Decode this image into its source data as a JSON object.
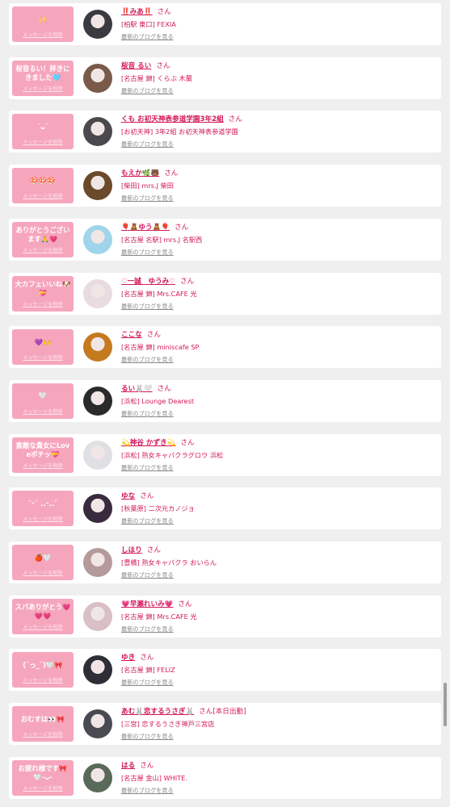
{
  "delete_label": "メッセージを削除",
  "blog_label": "最新のブログを見る",
  "san_label": "さん",
  "colors": {
    "accent": "#d2185a",
    "button_bg": "#f6a6bc",
    "background": "#efefef"
  },
  "rows": [
    {
      "message": "✨",
      "name": "‼️みあ‼️",
      "suffix": "さん",
      "shop": "[柏駅 東口] FEXIA",
      "avatar_color": "#3a3a40"
    },
    {
      "message": "桜音るい！拝きにきました🩵",
      "name": "桜音 るい",
      "suffix": "さん",
      "shop": "[名古屋 錦] くらぶ 木蘭",
      "avatar_color": "#7a5a4a"
    },
    {
      "message": "˙ᴗ˙",
      "name": "くも お初天神表参道学園3年2組",
      "suffix": "さん",
      "shop": "[お初天神] 3年2組 お初天神表参道学園",
      "avatar_color": "#4a4a4e"
    },
    {
      "message": "🍄🍄🍄",
      "name": "もえか🌿🐻",
      "suffix": "さん",
      "shop": "[柴田] mrs.J 柴田",
      "avatar_color": "#6a4a2a"
    },
    {
      "message": "ありがとうございます🙏💗",
      "name": "🎈🧸ゆう🧸🎈",
      "suffix": "さん",
      "shop": "[名古屋 名駅] mrs.J 名駅西",
      "avatar_color": "#9fd4ea"
    },
    {
      "message": "大カフェいいね🐶💝",
      "name": "♡一誠　ゆうみ♡",
      "suffix": "さん",
      "shop": "[名古屋 錦] Mrs.CAFE 光",
      "avatar_color": "#e8dce0"
    },
    {
      "message": "💜🙌",
      "name": "ここな",
      "suffix": "さん",
      "shop": "[名古屋 錦] miniscafe SP",
      "avatar_color": "#c47a1e"
    },
    {
      "message": "🤍",
      "name": "るい🐰🤍",
      "suffix": "さん",
      "shop": "[浜松] Lounge Dearest",
      "avatar_color": "#2a2a2a"
    },
    {
      "message": "素敵な貴女にLoveポチッ💝",
      "name": "💫神谷 かずき💫",
      "suffix": "さん",
      "shop": "[浜松] 熟女キャバクラグロウ 浜松",
      "avatar_color": "#e0e0e4"
    },
    {
      "message": "˘ᵕ˘ ..ᵕ..˘",
      "name": "ゆな",
      "suffix": "さん",
      "shop": "[秋葉原] 二次元カノジョ",
      "avatar_color": "#3a2a3e"
    },
    {
      "message": "🍎🤍",
      "name": "しほり",
      "suffix": "さん",
      "shop": "[豊橋] 熟女キャバクラ おいらん",
      "avatar_color": "#b49a9a"
    },
    {
      "message": "スパありがとう💗💗💗",
      "name": "💗早瀬れいみ💗",
      "suffix": "さん",
      "shop": "[名古屋 錦] Mrs.CAFE 光",
      "avatar_color": "#d8c0c4"
    },
    {
      "message": "(˘っ_˘)🤍🎀",
      "name": "ゆき",
      "suffix": "さん",
      "shop": "[名古屋 錦] FELIZ",
      "avatar_color": "#2e2e36"
    },
    {
      "message": "おむすは👀🎀",
      "name": "あむ🐰恋するうさぎ🐰",
      "suffix": "さん[本日出勤]",
      "shop": "[三宮] 恋するうさぎ神戸三宮店",
      "avatar_color": "#4a4a52"
    },
    {
      "message": "お疲れ様です🎀🤍-ᴗ-",
      "name": "はる",
      "suffix": "さん",
      "shop": "[名古屋 金山] WHITE.",
      "avatar_color": "#5a6a5a"
    }
  ]
}
